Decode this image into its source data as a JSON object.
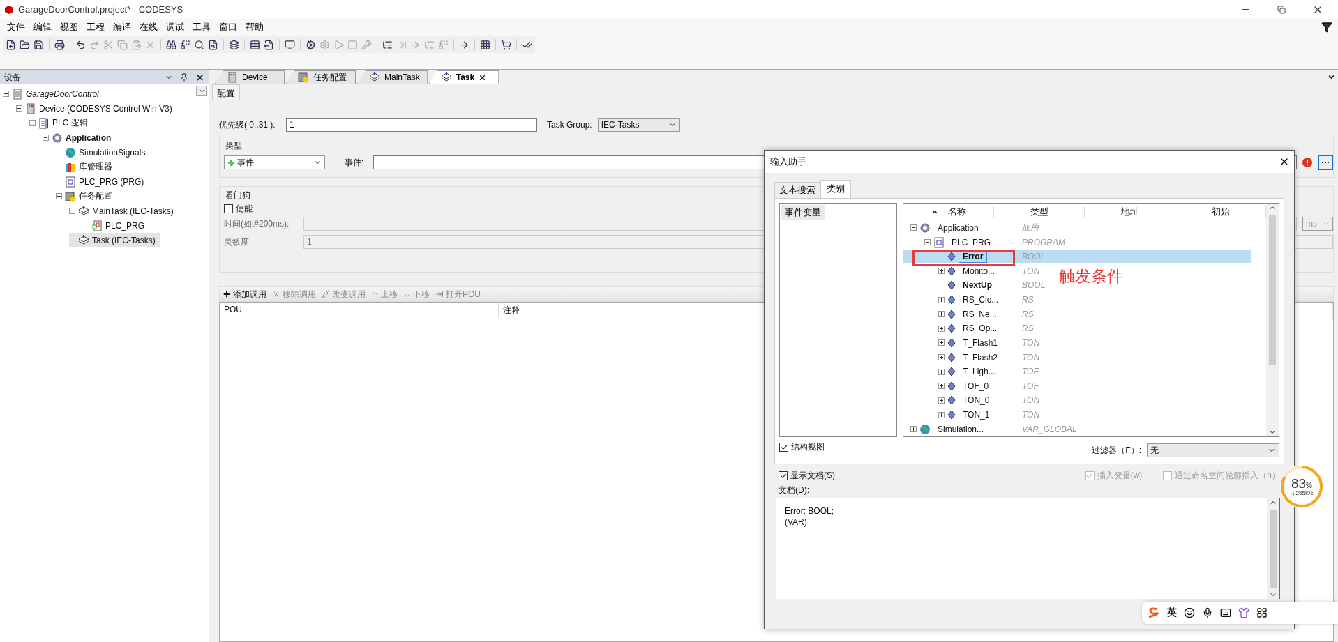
{
  "window": {
    "title": "GarageDoorControl.project* - CODESYS"
  },
  "menu": [
    "文件",
    "编辑",
    "视图",
    "工程",
    "编译",
    "在线",
    "调试",
    "工具",
    "窗口",
    "帮助"
  ],
  "devices_panel": {
    "title": "设备",
    "tree": [
      {
        "label": "GarageDoorControl",
        "kind": "project",
        "selected": false,
        "expanded": true,
        "children": [
          {
            "label": "Device (CODESYS Control Win V3)",
            "kind": "device",
            "selected": false,
            "expanded": true,
            "children": [
              {
                "label": "PLC 逻辑",
                "kind": "plc",
                "selected": false,
                "expanded": true,
                "children": [
                  {
                    "label": "Application",
                    "kind": "app",
                    "selected": false,
                    "expanded": true,
                    "children": [
                      {
                        "label": "SimulationSignals",
                        "kind": "globe",
                        "selected": false
                      },
                      {
                        "label": "库管理器",
                        "kind": "library",
                        "selected": false
                      },
                      {
                        "label": "PLC_PRG (PRG)",
                        "kind": "pou",
                        "selected": false
                      },
                      {
                        "label": "任务配置",
                        "kind": "taskconfig",
                        "selected": false,
                        "expanded": true,
                        "children": [
                          {
                            "label": "MainTask (IEC-Tasks)",
                            "kind": "task",
                            "selected": false,
                            "expanded": true,
                            "children": [
                              {
                                "label": "PLC_PRG",
                                "kind": "prg",
                                "selected": false
                              }
                            ]
                          },
                          {
                            "label": "Task (IEC-Tasks)",
                            "kind": "task",
                            "selected": true
                          }
                        ]
                      }
                    ]
                  }
                ]
              }
            ]
          }
        ]
      }
    ]
  },
  "editor_tabs": [
    {
      "label": "Device",
      "kind": "device",
      "selected": false
    },
    {
      "label": "任务配置",
      "kind": "taskconfig",
      "selected": false
    },
    {
      "label": "MainTask",
      "kind": "task",
      "selected": false
    },
    {
      "label": "Task",
      "kind": "task",
      "selected": true
    }
  ],
  "sub_tabs": [
    {
      "label": "配置",
      "selected": true
    }
  ],
  "config": {
    "priority_label": "优先级( 0..31 ):",
    "priority_value": "1",
    "task_group_label": "Task Group:",
    "task_group_value": "IEC-Tasks",
    "type_group": "类型",
    "type_value": "事件",
    "event_label": "事件:"
  },
  "watchdog": {
    "title": "看门狗",
    "enable": {
      "label": "使能",
      "checked": false
    },
    "time_label": "时间(如t#200ms):",
    "unit": "ms",
    "sensitivity_label": "灵敏度:",
    "sensitivity_value": "1"
  },
  "calls_toolbar": [
    {
      "label": "添加调用",
      "kind": "add",
      "disabled": false
    },
    {
      "label": "移除调用",
      "kind": "remove",
      "disabled": true
    },
    {
      "label": "改变调用",
      "kind": "edit",
      "disabled": true
    },
    {
      "label": "上移",
      "kind": "up",
      "disabled": true
    },
    {
      "label": "下移",
      "kind": "down",
      "disabled": true
    },
    {
      "label": "打开POU",
      "kind": "open",
      "disabled": true
    }
  ],
  "calls_table": {
    "columns": [
      "POU",
      "注释"
    ]
  },
  "input_dialog": {
    "title": "输入助手",
    "tabs": [
      {
        "label": "文本搜索",
        "selected": false
      },
      {
        "label": "类别",
        "selected": true
      }
    ],
    "categories": [
      {
        "label": "事件变量",
        "selected": true
      }
    ],
    "columns": [
      "名称",
      "类型",
      "地址",
      "初始"
    ],
    "tree": [
      {
        "label": "Application",
        "type": "应用",
        "kind": "app",
        "bold": false,
        "selected": false,
        "expanded": true,
        "children": [
          {
            "label": "PLC_PRG",
            "type": "PROGRAM",
            "kind": "pou",
            "bold": false,
            "selected": false,
            "expanded": true,
            "children": [
              {
                "label": "Error",
                "type": "BOOL",
                "kind": "var",
                "bold": true,
                "selected": true
              },
              {
                "label": "Monito...",
                "type": "TON",
                "kind": "var",
                "bold": false,
                "selected": false,
                "expanded": false
              },
              {
                "label": "NextUp",
                "type": "BOOL",
                "kind": "var",
                "bold": true,
                "selected": false
              },
              {
                "label": "RS_Clo...",
                "type": "RS",
                "kind": "var",
                "bold": false,
                "selected": false,
                "expanded": false
              },
              {
                "label": "RS_Ne...",
                "type": "RS",
                "kind": "var",
                "bold": false,
                "selected": false,
                "expanded": false
              },
              {
                "label": "RS_Op...",
                "type": "RS",
                "kind": "var",
                "bold": false,
                "selected": false,
                "expanded": false
              },
              {
                "label": "T_Flash1",
                "type": "TON",
                "kind": "var",
                "bold": false,
                "selected": false,
                "expanded": false
              },
              {
                "label": "T_Flash2",
                "type": "TON",
                "kind": "var",
                "bold": false,
                "selected": false,
                "expanded": false
              },
              {
                "label": "T_Ligh...",
                "type": "TOF",
                "kind": "var",
                "bold": false,
                "selected": false,
                "expanded": false
              },
              {
                "label": "TOF_0",
                "type": "TOF",
                "kind": "var",
                "bold": false,
                "selected": false,
                "expanded": false
              },
              {
                "label": "TON_0",
                "type": "TON",
                "kind": "var",
                "bold": false,
                "selected": false,
                "expanded": false
              },
              {
                "label": "TON_1",
                "type": "TON",
                "kind": "var",
                "bold": false,
                "selected": false,
                "expanded": false
              }
            ]
          }
        ]
      },
      {
        "label": "Simulation...",
        "type": "VAR_GLOBAL",
        "kind": "globe",
        "bold": false,
        "selected": false,
        "expanded": false
      }
    ],
    "annotation": "触发条件",
    "structure_view": {
      "label": "结构视图",
      "checked": true
    },
    "filter": {
      "label": "过滤器（F）:",
      "value": "无"
    },
    "show_doc": {
      "label": "显示文档(S)",
      "checked": true
    },
    "insert_var": {
      "label": "插入变量(w)",
      "checked": true,
      "disabled": true
    },
    "namespace_insert": {
      "label": "通过命名空间轮廓插入（n）",
      "checked": false,
      "disabled": true
    },
    "doc_label": "文档(D):",
    "doc_text": "Error: BOOL;\n(VAR)"
  },
  "speed_widget": {
    "percent": "83",
    "unit": "%",
    "rate": "255K/s"
  },
  "ime_toolbar": {
    "mode": "英"
  }
}
